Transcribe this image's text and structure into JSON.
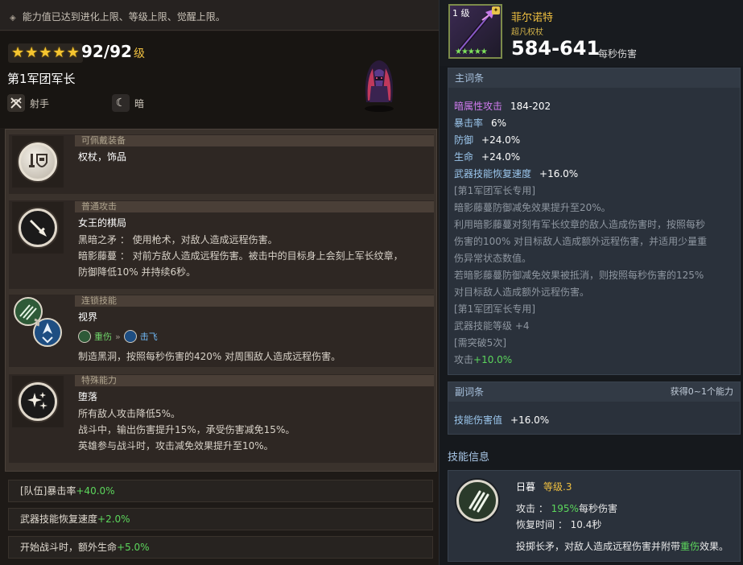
{
  "notice": {
    "text": "能力值已达到进化上限、等级上限、觉醒上限。"
  },
  "hero": {
    "stars": 5,
    "level": "92/92",
    "level_unit": "级",
    "name": "第1军团军长",
    "class_label": "射手",
    "element_label": "暗"
  },
  "sections": {
    "equip": {
      "tag": "可佩戴装备",
      "title": "权杖，饰品"
    },
    "normal": {
      "tag": "普通攻击",
      "title": "女王的棋局",
      "line1": "黑暗之矛 ： 使用枪术，对敌人造成远程伤害。",
      "line2": "暗影藤蔓 ： 对前方敌人造成远程伤害。被击中的目标身上会刻上军长纹章，",
      "line3": "防御降低10% 并持续6秒。"
    },
    "chain": {
      "tag": "连锁技能",
      "title": "视界",
      "from": "重伤",
      "to": "击飞",
      "desc": "制造黑洞，按照每秒伤害的420% 对周围敌人造成远程伤害。"
    },
    "special": {
      "tag": "特殊能力",
      "title": "堕落",
      "line1": "所有敌人攻击降低5%。",
      "line2": "战斗中，输出伤害提升15%，承受伤害减免15%。",
      "line3": "英雄参与战斗时，攻击减免效果提升至10%。"
    }
  },
  "bonuses": [
    {
      "label": "[队伍]暴击率",
      "value": "+40.0%"
    },
    {
      "label": "武器技能恢复速度",
      "value": "+2.0%"
    },
    {
      "label": "开始战斗时，额外生命",
      "value": "+5.0%"
    }
  ],
  "weapon": {
    "level": "1 级",
    "stars": 5,
    "name": "菲尔诺特",
    "type": "超凡权杖",
    "dps": "584-641",
    "dps_unit": "每秒伤害"
  },
  "main_options": {
    "header": "主词条",
    "stats": [
      {
        "key": "暗属性攻击",
        "value": "184-202"
      },
      {
        "key": "暴击率",
        "value": "6%"
      },
      {
        "key": "防御",
        "value": "+24.0%"
      },
      {
        "key": "生命",
        "value": "+24.0%"
      },
      {
        "key": "武器技能恢复速度",
        "value": "+16.0%"
      }
    ],
    "desc": [
      "[第1军团军长专用]",
      "暗影藤蔓防御减免效果提升至20%。",
      "利用暗影藤蔓对刻有军长纹章的敌人造成伤害时，按照每秒",
      "伤害的100% 对目标敌人造成额外远程伤害，并适用少量重",
      "伤异常状态数值。",
      "若暗影藤蔓防御减免效果被抵消，则按照每秒伤害的125%",
      "对目标敌人造成额外远程伤害。",
      "[第1军团军长专用]",
      "武器技能等级 +4",
      "[需突破5次]"
    ],
    "atk_label": "攻击",
    "atk_value": "+10.0%"
  },
  "sub_options": {
    "header": "副词条",
    "note": "获得0~1个能力",
    "key": "技能伤害值",
    "value": "+16.0%"
  },
  "skill": {
    "header": "技能信息",
    "name": "日暮",
    "level": "等级.3",
    "atk_label": "攻击 ：",
    "atk_value": "195%",
    "atk_unit": "每秒伤害",
    "cd_label": "恢复时间 ：",
    "cd_value": "10.4秒",
    "desc_pre": "投掷长矛，对敌人造成远程伤害并附带",
    "desc_hl": "重伤",
    "desc_post": "效果。"
  }
}
